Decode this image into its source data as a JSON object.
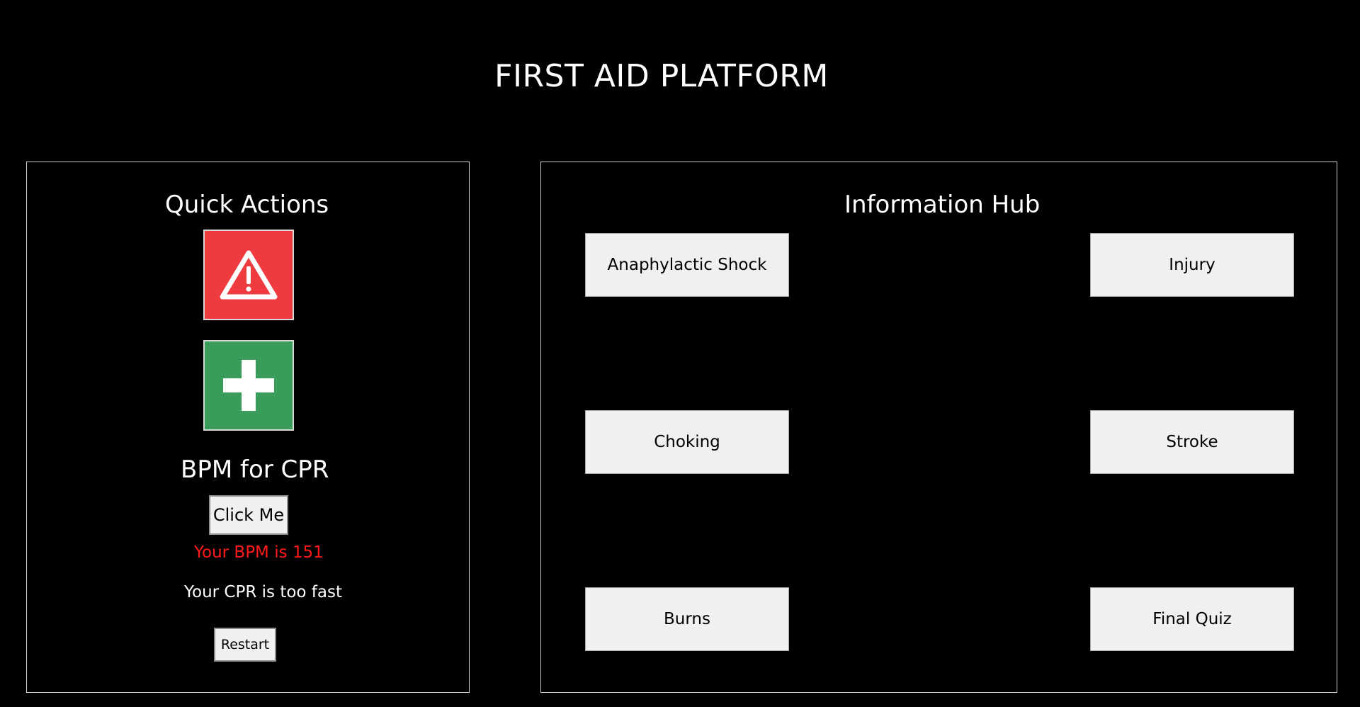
{
  "app": {
    "title": "FIRST AID PLATFORM"
  },
  "quick_actions": {
    "title": "Quick Actions",
    "warning_tile": {
      "icon": "warning-triangle-icon",
      "color": "#ef3b40"
    },
    "first_aid_tile": {
      "icon": "plus-cross-icon",
      "color": "#3a9c5b"
    },
    "bpm": {
      "heading": "BPM for CPR",
      "click_label": "Click Me",
      "result_text": "Your BPM is 151",
      "result_color": "#ff1a1a",
      "status_text": "Your CPR is too fast",
      "restart_label": "Restart"
    }
  },
  "information_hub": {
    "title": "Information Hub",
    "topics": [
      {
        "label": "Anaphylactic Shock"
      },
      {
        "label": "Injury"
      },
      {
        "label": "Choking"
      },
      {
        "label": "Stroke"
      },
      {
        "label": "Burns"
      },
      {
        "label": "Final Quiz"
      }
    ]
  }
}
